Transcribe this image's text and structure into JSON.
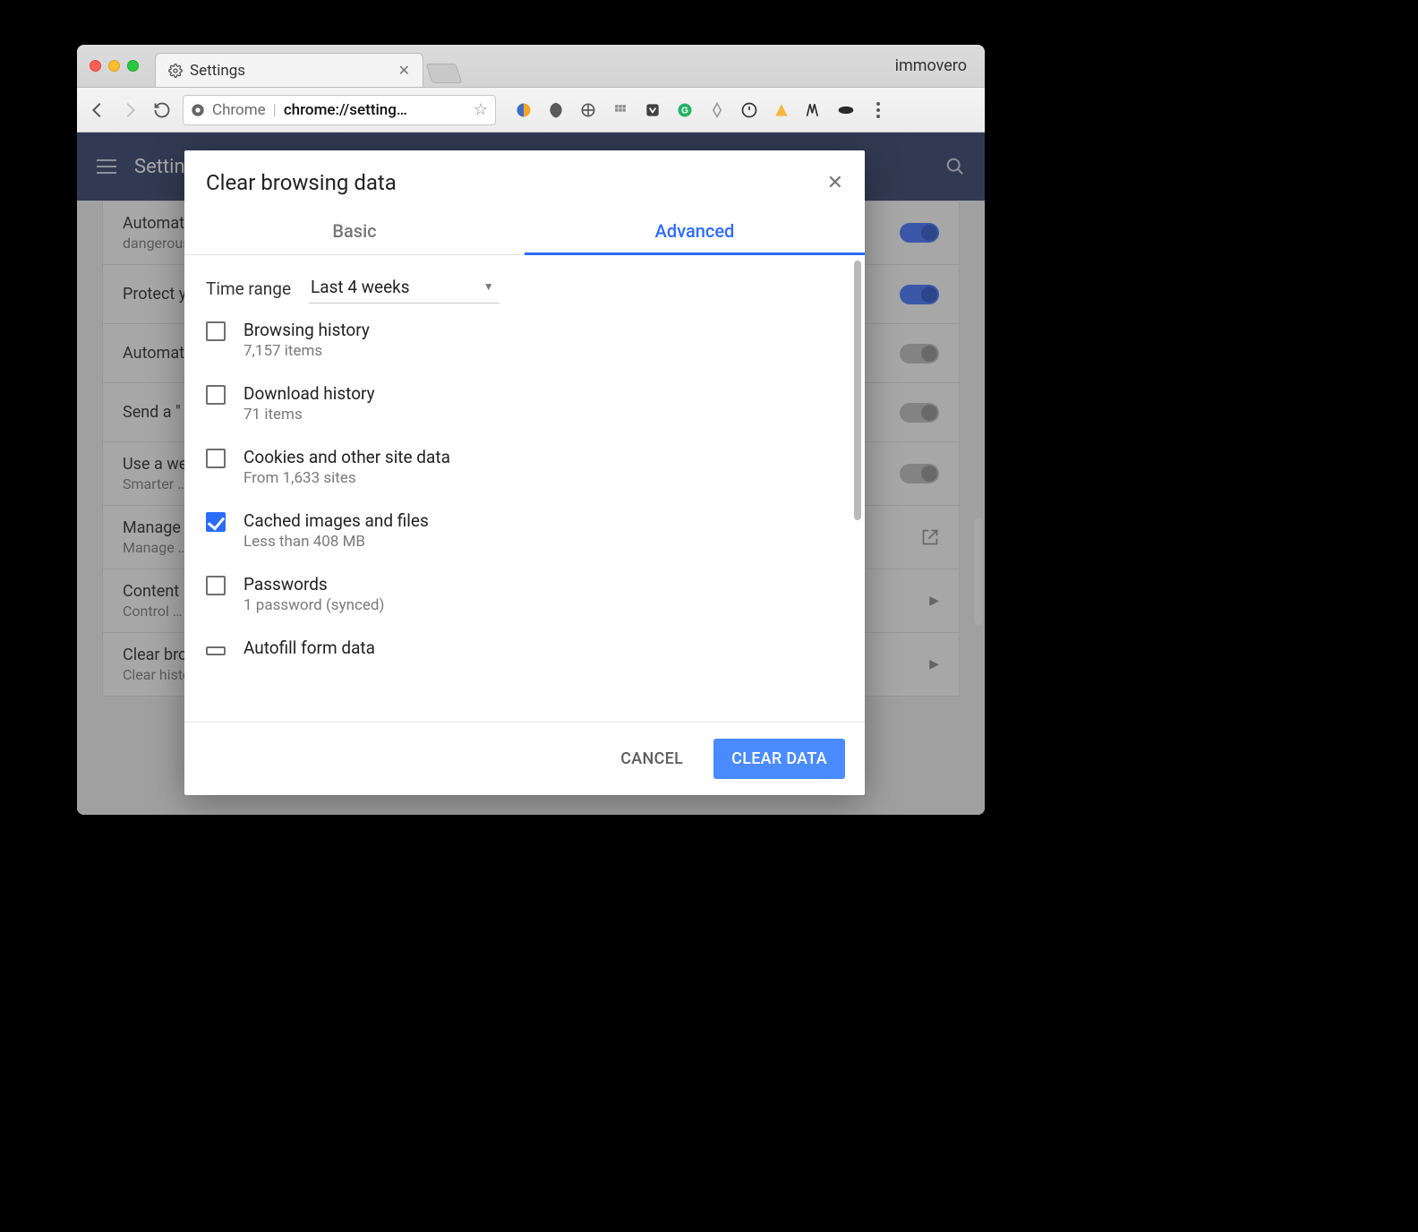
{
  "browser": {
    "profile_name": "immovero",
    "tab_title": "Settings",
    "omnibox": {
      "origin_label": "Chrome",
      "url_display": "chrome://setting…"
    }
  },
  "settings_header": {
    "title": "Settings"
  },
  "settings_rows": [
    {
      "title": "Automatically …",
      "subtitle": "dangerous …",
      "control": "toggle-on"
    },
    {
      "title": "Protect you …",
      "subtitle": "",
      "control": "toggle-on"
    },
    {
      "title": "Automatically …",
      "subtitle": "",
      "control": "toggle-off"
    },
    {
      "title": "Send a \" …",
      "subtitle": "",
      "control": "toggle-off"
    },
    {
      "title": "Use a web …",
      "subtitle": "Smarter …",
      "control": "toggle-off"
    },
    {
      "title": "Manage …",
      "subtitle": "Manage …",
      "control": "open-external"
    },
    {
      "title": "Content …",
      "subtitle": "Control …",
      "control": "chevron"
    },
    {
      "title": "Clear browsing …",
      "subtitle": "Clear history …",
      "control": "chevron"
    }
  ],
  "dialog": {
    "title": "Clear browsing data",
    "tabs": {
      "basic": "Basic",
      "advanced": "Advanced",
      "active": "advanced"
    },
    "time_range": {
      "label": "Time range",
      "value": "Last 4 weeks"
    },
    "items": [
      {
        "label": "Browsing history",
        "sublabel": "7,157 items",
        "checked": false
      },
      {
        "label": "Download history",
        "sublabel": "71 items",
        "checked": false
      },
      {
        "label": "Cookies and other site data",
        "sublabel": "From 1,633 sites",
        "checked": false
      },
      {
        "label": "Cached images and files",
        "sublabel": "Less than 408 MB",
        "checked": true
      },
      {
        "label": "Passwords",
        "sublabel": "1 password (synced)",
        "checked": false
      },
      {
        "label": "Autofill form data",
        "sublabel": "",
        "checked": false
      }
    ],
    "buttons": {
      "cancel": "CANCEL",
      "confirm": "CLEAR DATA"
    }
  }
}
